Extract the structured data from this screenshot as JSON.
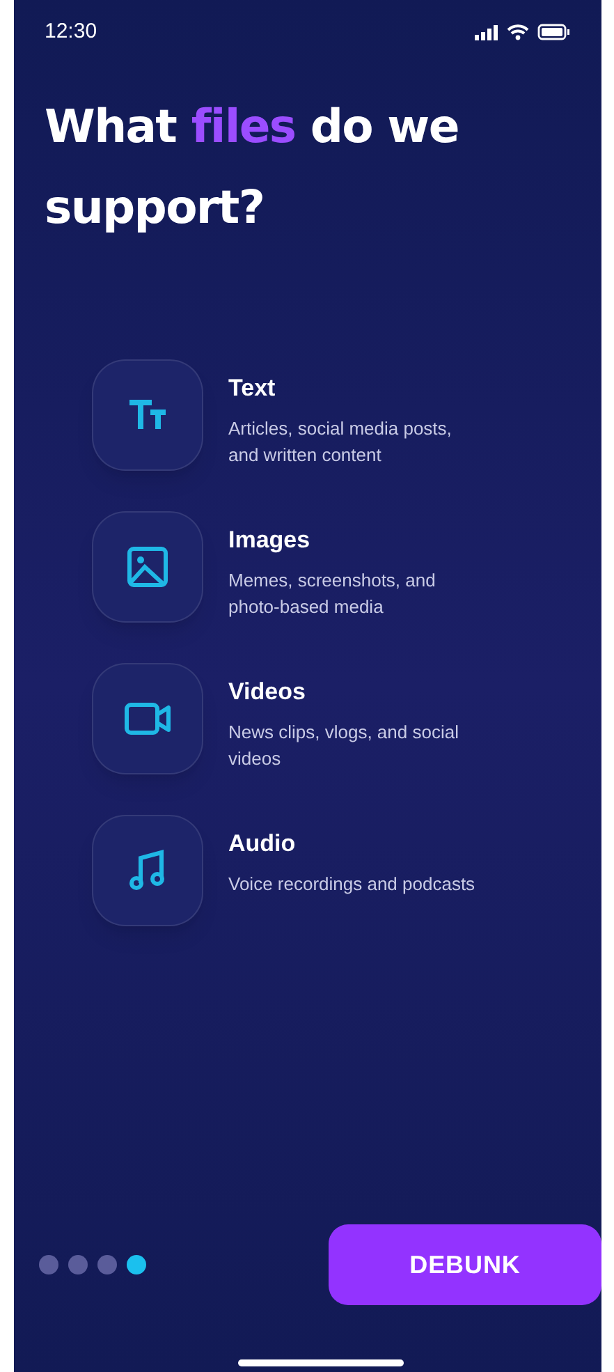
{
  "status_bar": {
    "time": "12:30"
  },
  "title": [
    {
      "text": "What",
      "highlight": false
    },
    {
      "text": "files",
      "highlight": true
    },
    {
      "text": "do we support?",
      "highlight": false
    }
  ],
  "file_types": [
    {
      "kind": "text",
      "name": "Text",
      "description": "Articles, social media posts, and written content"
    },
    {
      "kind": "image",
      "name": "Images",
      "description": "Memes, screenshots, and photo-based media"
    },
    {
      "kind": "video",
      "name": "Videos",
      "description": "News clips, vlogs, and social videos"
    },
    {
      "kind": "audio",
      "name": "Audio",
      "description": "Voice recordings and podcasts"
    }
  ],
  "pager": [
    {
      "selected": false
    },
    {
      "selected": false
    },
    {
      "selected": false
    },
    {
      "selected": true
    }
  ],
  "button": {
    "label": "DEBUNK"
  }
}
